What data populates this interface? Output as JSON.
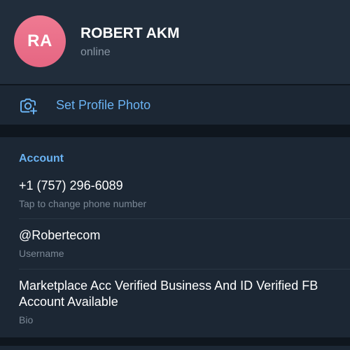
{
  "profile": {
    "initials": "RA",
    "name": "ROBERT AKM",
    "status": "online",
    "avatar_gradient": [
      "#ef7a92",
      "#e56682"
    ]
  },
  "photo_action": {
    "icon": "camera-add-icon",
    "label": "Set Profile Photo"
  },
  "account": {
    "title": "Account",
    "phone": {
      "value": "+1 (757) 296-6089",
      "label": "Tap to change phone number"
    },
    "username": {
      "value": "@Robertecom",
      "label": "Username"
    },
    "bio": {
      "value": "Marketplace Acc Verified Business And ID Verified FB Account Available",
      "label": "Bio"
    }
  },
  "colors": {
    "background": "#0f161e",
    "card": "#1c2734",
    "header": "#212d3b",
    "accent": "#6ab3f3",
    "secondary_text": "#7b8896"
  }
}
